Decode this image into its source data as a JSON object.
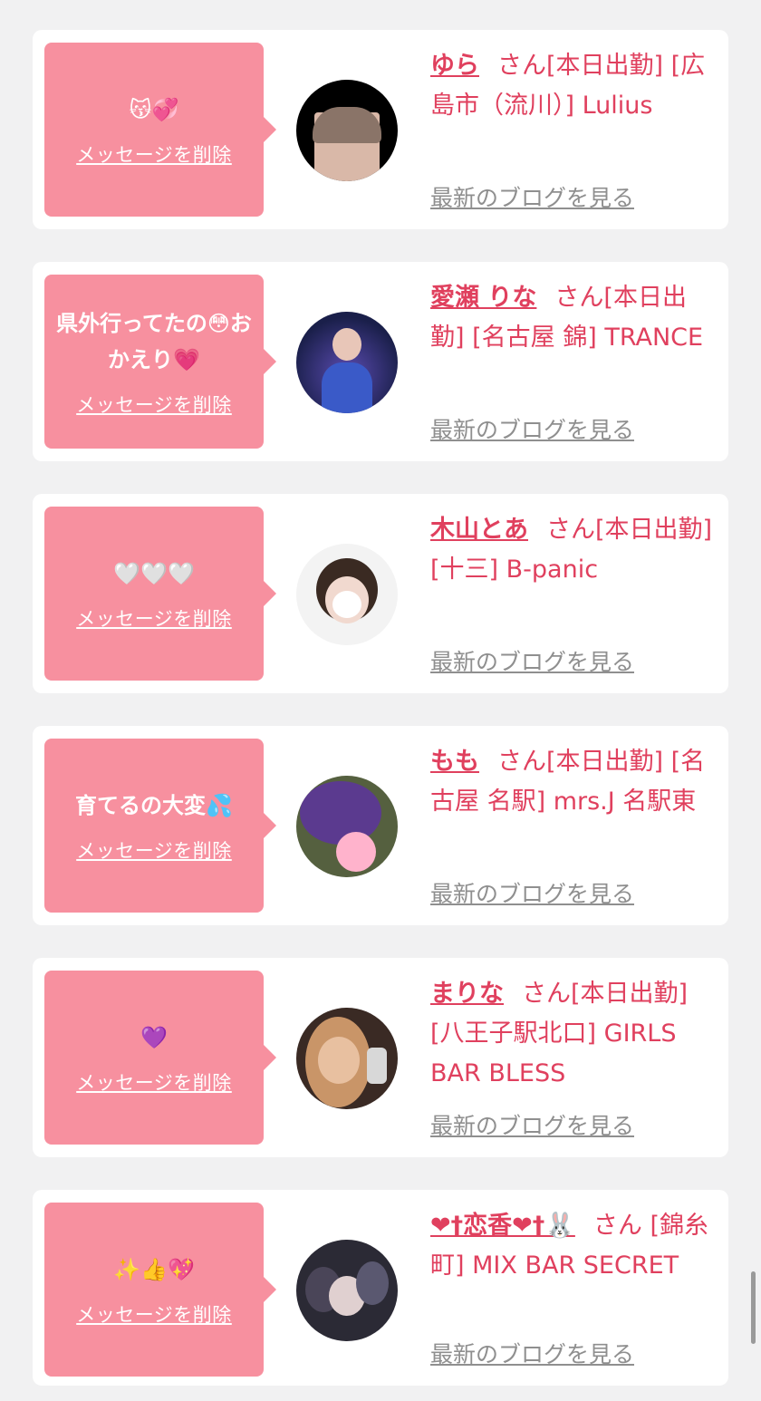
{
  "cards": [
    {
      "message": "😽💞",
      "delete_label": "メッセージを削除",
      "name": "ゆら",
      "info": "さん[本日出勤] [広島市（流川）] Lulius",
      "blog_label": "最新のブログを見る",
      "avatar_colors": [
        "#000000",
        "#d9b8a8",
        "#6a5a50"
      ]
    },
    {
      "message": "県外行ってたの😳おかえり💗",
      "delete_label": "メッセージを削除",
      "name": "愛瀬 りな",
      "info": "さん[本日出勤] [名古屋 錦] TRANCE",
      "blog_label": "最新のブログを見る",
      "avatar_colors": [
        "#1a1f4a",
        "#5a4bb0",
        "#e8c6b8"
      ]
    },
    {
      "message": "🤍🤍🤍",
      "delete_label": "メッセージを削除",
      "name": "木山とあ",
      "info": "さん[本日出勤] [十三] B-panic",
      "blog_label": "最新のブログを見る",
      "avatar_colors": [
        "#f3f3f3",
        "#3a2a22",
        "#f1d9cf"
      ]
    },
    {
      "message": "育てるの大変💦",
      "delete_label": "メッセージを削除",
      "name": "もも",
      "info": "さん[本日出勤] [名古屋 名駅] mrs.J 名駅東",
      "blog_label": "最新のブログを見る",
      "avatar_colors": [
        "#55603f",
        "#5b3a8f",
        "#ffb3cc"
      ]
    },
    {
      "message": "💜",
      "delete_label": "メッセージを削除",
      "name": "まりな",
      "info": "さん[本日出勤] [八王子駅北口] GIRLS BAR BLESS",
      "blog_label": "最新のブログを見る",
      "avatar_colors": [
        "#3a2a24",
        "#c99568",
        "#e8c0a0"
      ]
    },
    {
      "message": "✨👍💖",
      "delete_label": "メッセージを削除",
      "name": "❤︎†恋香❤︎†🐰",
      "info": "さん [錦糸町] MIX BAR SECRET",
      "blog_label": "最新のブログを見る",
      "avatar_colors": [
        "#2b2a35",
        "#5a5870",
        "#e0d0d0"
      ]
    }
  ]
}
